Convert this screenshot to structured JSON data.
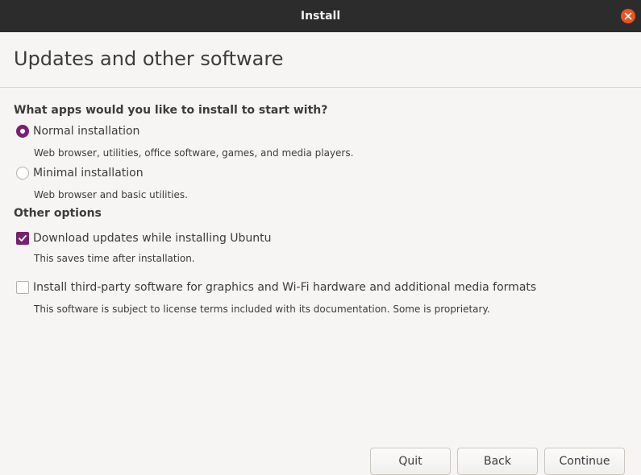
{
  "window": {
    "title": "Install",
    "close_icon": "close-icon",
    "accent_color": "#e95420"
  },
  "header": {
    "title": "Updates and other software"
  },
  "apps_section": {
    "heading": "What apps would you like to install to start with?",
    "options": [
      {
        "label": "Normal installation",
        "description": "Web browser, utilities, office software, games, and media players.",
        "selected": true
      },
      {
        "label": "Minimal installation",
        "description": "Web browser and basic utilities.",
        "selected": false
      }
    ]
  },
  "other_section": {
    "heading": "Other options",
    "options": [
      {
        "label": "Download updates while installing Ubuntu",
        "description": "This saves time after installation.",
        "checked": true
      },
      {
        "label": "Install third-party software for graphics and Wi-Fi hardware and additional media formats",
        "description": "This software is subject to license terms included with its documentation. Some is proprietary.",
        "checked": false
      }
    ]
  },
  "buttons": {
    "quit": "Quit",
    "back": "Back",
    "continue": "Continue"
  },
  "colors": {
    "selected": "#77216f",
    "titlebar": "#2c2c2c",
    "background": "#f6f5f4"
  }
}
